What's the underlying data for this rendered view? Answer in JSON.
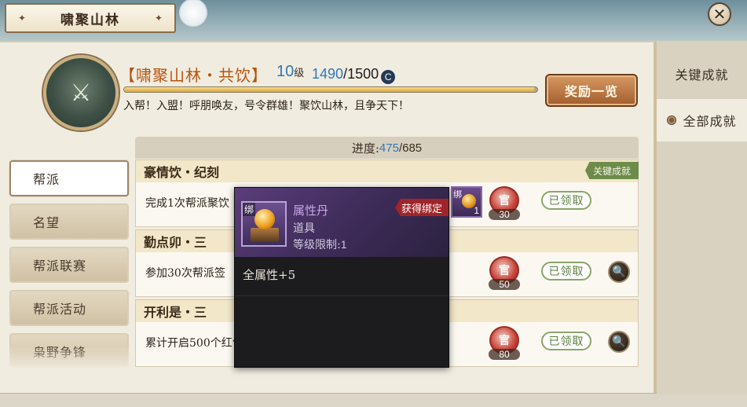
{
  "window": {
    "title": "啸聚山林",
    "close_label": "✕"
  },
  "guild": {
    "name": "【啸聚山林・共饮】",
    "level": "10",
    "level_unit": "级",
    "exp_current": "1490",
    "exp_separator": "/",
    "exp_max": "1500",
    "exp_icon_label": "C",
    "exp_fraction": 0.993,
    "motto": "入帮！入盟！呼朋唤友，号令群雄！聚饮山林，且争天下！",
    "emblem_glyph": "⚔"
  },
  "reward_button": {
    "label": "奖励一览"
  },
  "right_tabs": [
    {
      "label": "关键成就"
    },
    {
      "label": "全部成就"
    }
  ],
  "nav": [
    {
      "label": "帮派"
    },
    {
      "label": "名望"
    },
    {
      "label": "帮派联赛"
    },
    {
      "label": "帮派活动"
    },
    {
      "label": "枭野争锋"
    }
  ],
  "progress": {
    "label": "进度:",
    "current": "475",
    "separator": "/",
    "total": "685"
  },
  "achievements": [
    {
      "title": "豪情饮・纪刻",
      "tag": "关键成就",
      "desc": "完成1次帮派聚饮",
      "token_glyph": "官",
      "token_count": "30",
      "status": "已领取",
      "item_bind": "绑",
      "item_count": "1"
    },
    {
      "title": "勤点卯・三",
      "desc": "参加30次帮派签",
      "token_glyph": "官",
      "token_count": "50",
      "status": "已领取",
      "search_icon": "🔍"
    },
    {
      "title": "开利是・三",
      "desc": "累计开启500个红包",
      "token_glyph": "官",
      "token_count": "80",
      "status": "已领取",
      "search_icon": "🔍"
    }
  ],
  "tooltip": {
    "bind_mark": "绑",
    "name": "属性丹",
    "type": "道具",
    "level_label": "等级限制:",
    "level_value": "1",
    "bind_tag": "获得绑定",
    "attr": "全属性+5"
  },
  "colors": {
    "accent_orange": "#b8540f",
    "accent_blue": "#2f78b8",
    "key_tag_green": "#6d8c4a",
    "bind_red": "#a1242a",
    "item_purple": "#c7a5ea"
  }
}
